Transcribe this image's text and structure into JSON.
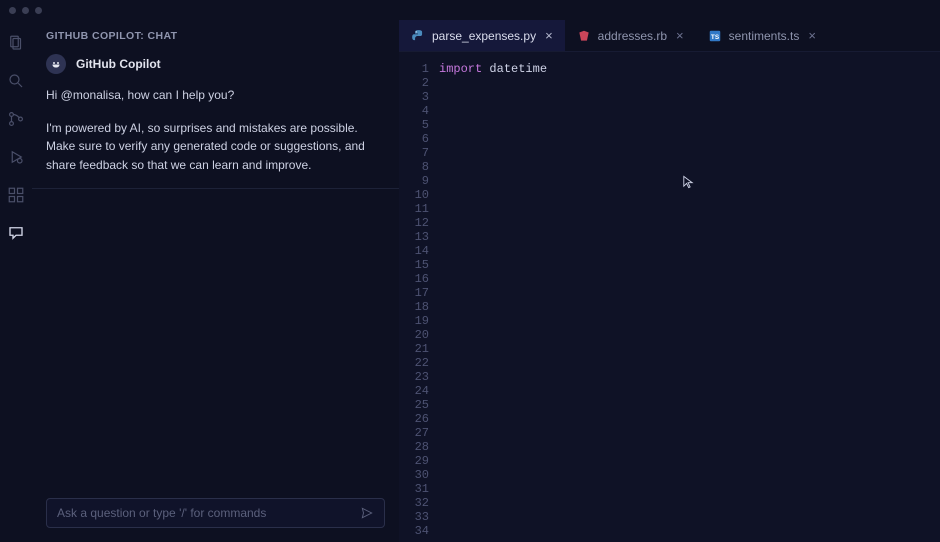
{
  "chat": {
    "header": "GITHUB COPILOT: CHAT",
    "bot_name": "GitHub Copilot",
    "messages": [
      "Hi @monalisa, how can I help you?",
      "I'm powered by AI, so surprises and mistakes are possible. Make sure to verify any generated code or suggestions, and share feedback so that we can learn and improve."
    ],
    "input_placeholder": "Ask a question or type '/' for commands"
  },
  "tabs": [
    {
      "label": "parse_expenses.py",
      "icon": "python",
      "active": true
    },
    {
      "label": "addresses.rb",
      "icon": "ruby",
      "active": false
    },
    {
      "label": "sentiments.ts",
      "icon": "ts",
      "active": false
    }
  ],
  "editor": {
    "line_count": 34,
    "lines": [
      {
        "tokens": [
          {
            "t": "import",
            "c": "kw"
          },
          {
            "t": " ",
            "c": ""
          },
          {
            "t": "datetime",
            "c": "id"
          }
        ]
      }
    ]
  }
}
